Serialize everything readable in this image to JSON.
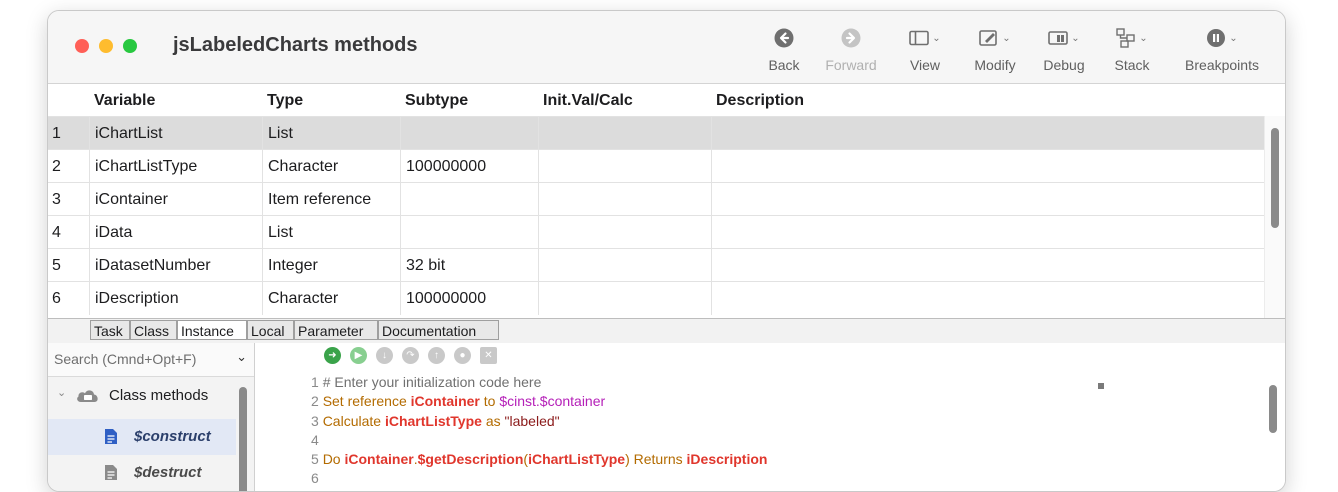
{
  "window": {
    "title": "jsLabeledCharts methods"
  },
  "toolbar": {
    "items": [
      {
        "label": "Back",
        "icon": "back-arrow-icon",
        "enabled": true
      },
      {
        "label": "Forward",
        "icon": "forward-arrow-icon",
        "enabled": false
      },
      {
        "label": "View",
        "icon": "view-layout-icon",
        "enabled": true
      },
      {
        "label": "Modify",
        "icon": "modify-edit-icon",
        "enabled": true
      },
      {
        "label": "Debug",
        "icon": "debug-icon",
        "enabled": true
      },
      {
        "label": "Stack",
        "icon": "stack-icon",
        "enabled": true
      },
      {
        "label": "Breakpoints",
        "icon": "pause-breakpoint-icon",
        "enabled": true
      }
    ]
  },
  "grid": {
    "columns": [
      "Variable",
      "Type",
      "Subtype",
      "Init.Val/Calc",
      "Description"
    ],
    "rows": [
      {
        "num": "1",
        "variable": "iChartList",
        "type": "List",
        "subtype": "",
        "init": "",
        "description": "",
        "selected": true
      },
      {
        "num": "2",
        "variable": "iChartListType",
        "type": "Character",
        "subtype": "100000000",
        "init": "",
        "description": ""
      },
      {
        "num": "3",
        "variable": "iContainer",
        "type": "Item reference",
        "subtype": "",
        "init": "",
        "description": ""
      },
      {
        "num": "4",
        "variable": "iData",
        "type": "List",
        "subtype": "",
        "init": "",
        "description": ""
      },
      {
        "num": "5",
        "variable": "iDatasetNumber",
        "type": "Integer",
        "subtype": "32 bit",
        "init": "",
        "description": ""
      },
      {
        "num": "6",
        "variable": "iDescription",
        "type": "Character",
        "subtype": "100000000",
        "init": "",
        "description": ""
      }
    ]
  },
  "tabs": [
    "Task",
    "Class",
    "Instance",
    "Local",
    "Parameter",
    "Documentation"
  ],
  "active_tab": "Instance",
  "search": {
    "placeholder": "Search (Cmnd+Opt+F)"
  },
  "tree": {
    "group_label": "Class methods",
    "items": [
      "$construct",
      "$destruct"
    ],
    "selected": "$construct"
  },
  "code": {
    "lines": [
      {
        "n": "1",
        "text": "# Enter your initialization code here"
      },
      {
        "n": "2",
        "text": "Set reference iContainer to $cinst.$container"
      },
      {
        "n": "3",
        "text": "Calculate iChartListType as \"labeled\""
      },
      {
        "n": "4",
        "text": ""
      },
      {
        "n": "5",
        "text": "Do iContainer.$getDescription(iChartListType) Returns iDescription"
      },
      {
        "n": "6",
        "text": ""
      }
    ]
  },
  "colors": {
    "code_keyword": "#b36b00",
    "code_variable": "#e0362c",
    "code_notation": "#b520b8",
    "code_string": "#8b1a1a",
    "selected_row": "#dcdcdc"
  }
}
